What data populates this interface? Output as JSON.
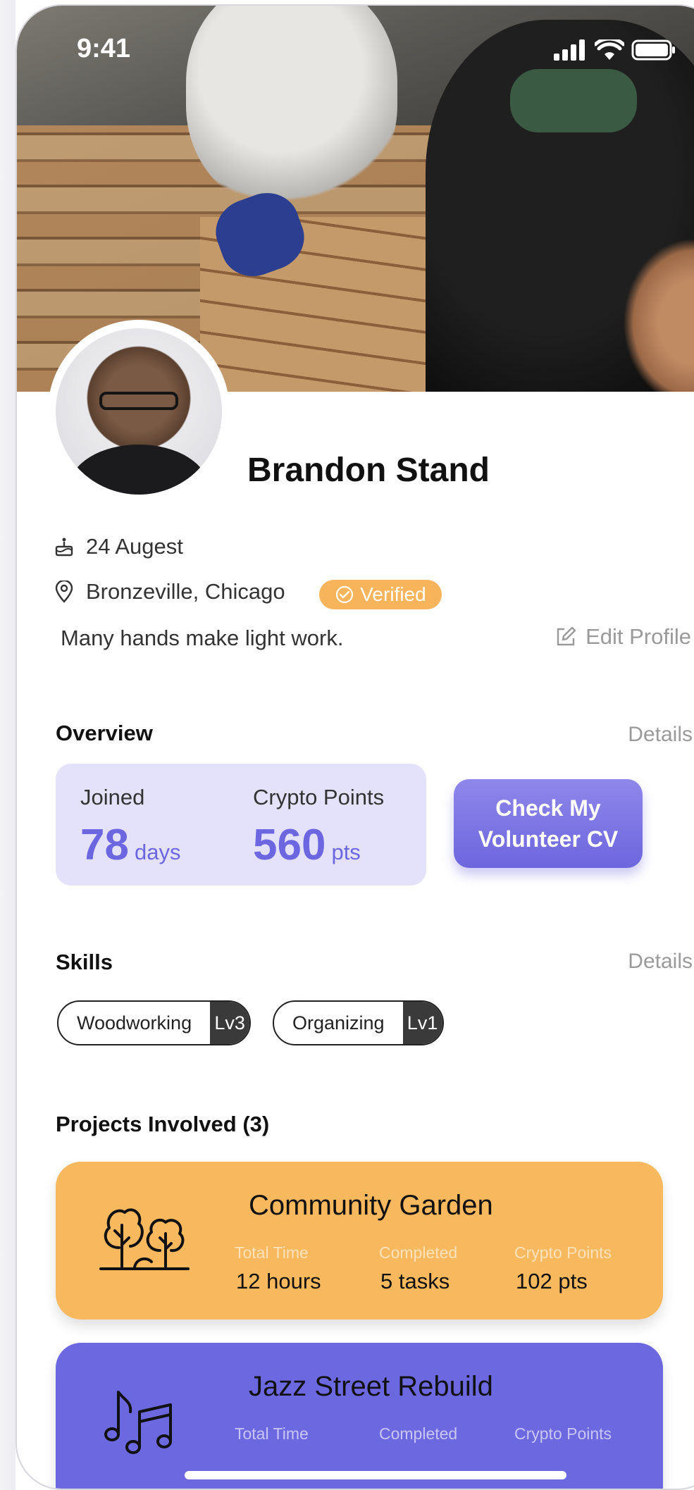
{
  "status_bar": {
    "time": "9:41"
  },
  "profile": {
    "name": "Brandon Stand",
    "birthday": "24 Augest",
    "location": "Bronzeville, Chicago",
    "verified_label": "Verified",
    "bio": "Many hands make light work.",
    "edit_label": "Edit Profile"
  },
  "overview": {
    "title": "Overview",
    "details_label": "Details",
    "joined_label": "Joined",
    "joined_value": "78",
    "joined_unit": "days",
    "points_label": "Crypto Points",
    "points_value": "560",
    "points_unit": "pts",
    "cv_button_line1": "Check My",
    "cv_button_line2": "Volunteer CV"
  },
  "skills": {
    "title": "Skills",
    "details_label": "Details",
    "items": [
      {
        "name": "Woodworking",
        "level": "Lv3"
      },
      {
        "name": "Organizing",
        "level": "Lv1"
      }
    ]
  },
  "projects": {
    "title": "Projects Involved (3)",
    "items": [
      {
        "name": "Community Garden",
        "icon": "trees-icon",
        "color": "#f7b85e",
        "total_time_label": "Total Time",
        "total_time": "12 hours",
        "completed_label": "Completed",
        "completed": "5 tasks",
        "points_label": "Crypto Points",
        "points": "102 pts"
      },
      {
        "name": "Jazz Street Rebuild",
        "icon": "music-notes-icon",
        "color": "#6c68e0",
        "total_time_label": "Total Time",
        "completed_label": "Completed",
        "points_label": "Crypto Points"
      }
    ]
  }
}
